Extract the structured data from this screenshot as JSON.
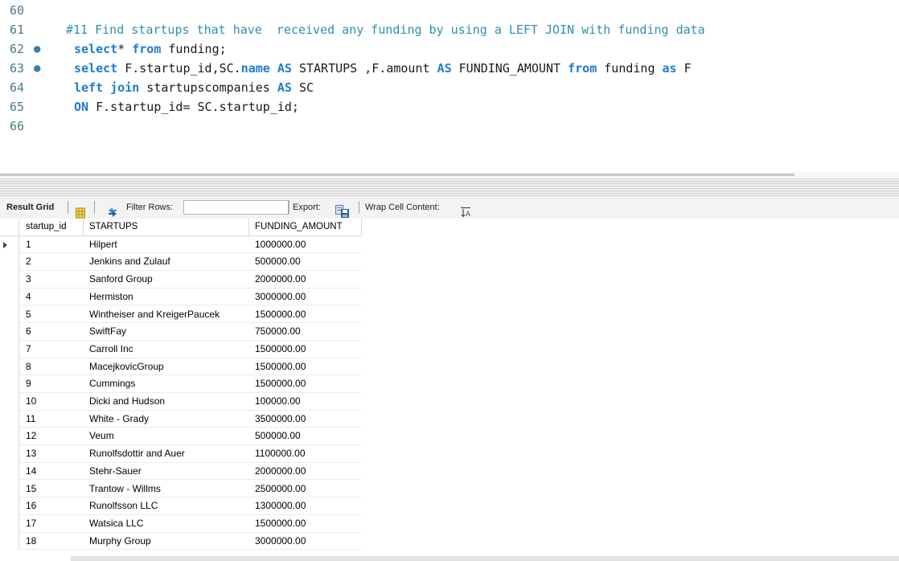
{
  "editor": {
    "lines": [
      {
        "num": "60",
        "dot": "",
        "text": "",
        "type": "code"
      },
      {
        "num": "61",
        "dot": "",
        "text": "#11 Find startups that have  received any funding by using a LEFT JOIN with funding data",
        "type": "comment"
      },
      {
        "num": "62",
        "dot": "●",
        "type": "code",
        "tokens": [
          {
            "t": "select",
            "kw": true
          },
          {
            "t": "* ",
            "kw": false
          },
          {
            "t": "from",
            "kw": true
          },
          {
            "t": " funding;",
            "kw": false
          }
        ]
      },
      {
        "num": "63",
        "dot": "●",
        "type": "code",
        "tokens": [
          {
            "t": "select",
            "kw": true
          },
          {
            "t": " F.startup_id,SC.",
            "kw": false
          },
          {
            "t": "name",
            "kw": true
          },
          {
            "t": " ",
            "kw": false
          },
          {
            "t": "AS",
            "kw": true
          },
          {
            "t": " STARTUPS ,F.amount ",
            "kw": false
          },
          {
            "t": "AS",
            "kw": true
          },
          {
            "t": " FUNDING_AMOUNT ",
            "kw": false
          },
          {
            "t": "from",
            "kw": true
          },
          {
            "t": " funding ",
            "kw": false
          },
          {
            "t": "as",
            "kw": true
          },
          {
            "t": " F",
            "kw": false
          }
        ]
      },
      {
        "num": "64",
        "dot": "",
        "type": "code",
        "tokens": [
          {
            "t": "left",
            "kw": true
          },
          {
            "t": " ",
            "kw": false
          },
          {
            "t": "join",
            "kw": true
          },
          {
            "t": " startupscompanies ",
            "kw": false
          },
          {
            "t": "AS",
            "kw": true
          },
          {
            "t": " SC",
            "kw": false
          }
        ]
      },
      {
        "num": "65",
        "dot": "",
        "type": "code",
        "tokens": [
          {
            "t": "ON",
            "kw": true
          },
          {
            "t": " F.startup_id= SC.startup_id;",
            "kw": false
          }
        ]
      },
      {
        "num": "66",
        "dot": "",
        "text": "",
        "type": "code"
      }
    ]
  },
  "toolbar": {
    "result_grid_label": "Result Grid",
    "filter_rows_label": "Filter Rows:",
    "filter_value": "",
    "export_label": "Export:",
    "wrap_label": "Wrap Cell Content:",
    "icons": [
      "grid-icon",
      "refresh-icon",
      "export-icon",
      "wrap-icon"
    ]
  },
  "grid": {
    "columns": [
      "startup_id",
      "STARTUPS",
      "FUNDING_AMOUNT"
    ],
    "rows": [
      [
        "1",
        "Hilpert",
        "1000000.00"
      ],
      [
        "2",
        "Jenkins and Zulauf",
        "500000.00"
      ],
      [
        "3",
        "Sanford Group",
        "2000000.00"
      ],
      [
        "4",
        "Hermiston",
        "3000000.00"
      ],
      [
        "5",
        " Wintheiser and KreigerPaucek",
        "1500000.00"
      ],
      [
        "6",
        "SwiftFay",
        "750000.00"
      ],
      [
        "7",
        "Carroll Inc",
        "1500000.00"
      ],
      [
        "8",
        "MacejkovicGroup",
        "1500000.00"
      ],
      [
        "9",
        "Cummings",
        "1500000.00"
      ],
      [
        "10",
        "Dicki and Hudson",
        "100000.00"
      ],
      [
        "11",
        "White - Grady",
        "3500000.00"
      ],
      [
        "12",
        "Veum",
        "500000.00"
      ],
      [
        "13",
        "Runolfsdottir and Auer",
        "1100000.00"
      ],
      [
        "14",
        "Stehr-Sauer",
        "2000000.00"
      ],
      [
        "15",
        "Trantow - Willms",
        "2500000.00"
      ],
      [
        "16",
        "Runolfsson LLC",
        "1300000.00"
      ],
      [
        "17",
        "Watsica LLC",
        "1500000.00"
      ],
      [
        "18",
        "Murphy Group",
        "3000000.00"
      ]
    ]
  }
}
